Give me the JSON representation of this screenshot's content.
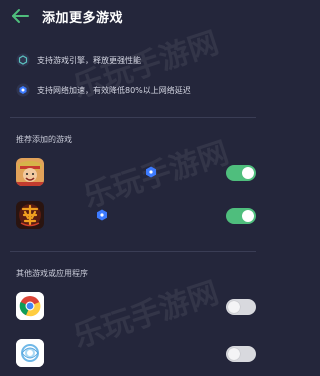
{
  "header": {
    "title": "添加更多游戏"
  },
  "features": [
    {
      "text": "支持游戏引擎，释放更强性能",
      "icon": "engine-icon"
    },
    {
      "text": "支持网络加速，有效降低80%以上网络延迟",
      "icon": "network-icon"
    }
  ],
  "recommended": {
    "title": "推荐添加的游戏",
    "apps": [
      {
        "icon": "one-piece-game-icon",
        "badge": "accelerator-badge-icon",
        "enabled": true
      },
      {
        "icon": "jian-game-icon",
        "badge": "accelerator-badge-icon",
        "enabled": true
      }
    ]
  },
  "others": {
    "title": "其他游戏或应用程序",
    "apps": [
      {
        "icon": "chrome-icon",
        "enabled": false
      },
      {
        "icon": "gallery-app-icon",
        "enabled": false
      }
    ]
  },
  "watermark": "乐玩手游网",
  "colors": {
    "background": "#24263b",
    "toggle_on": "#4fbe7d",
    "toggle_off": "#d8d9de",
    "accent_blue": "#3d7bff"
  }
}
